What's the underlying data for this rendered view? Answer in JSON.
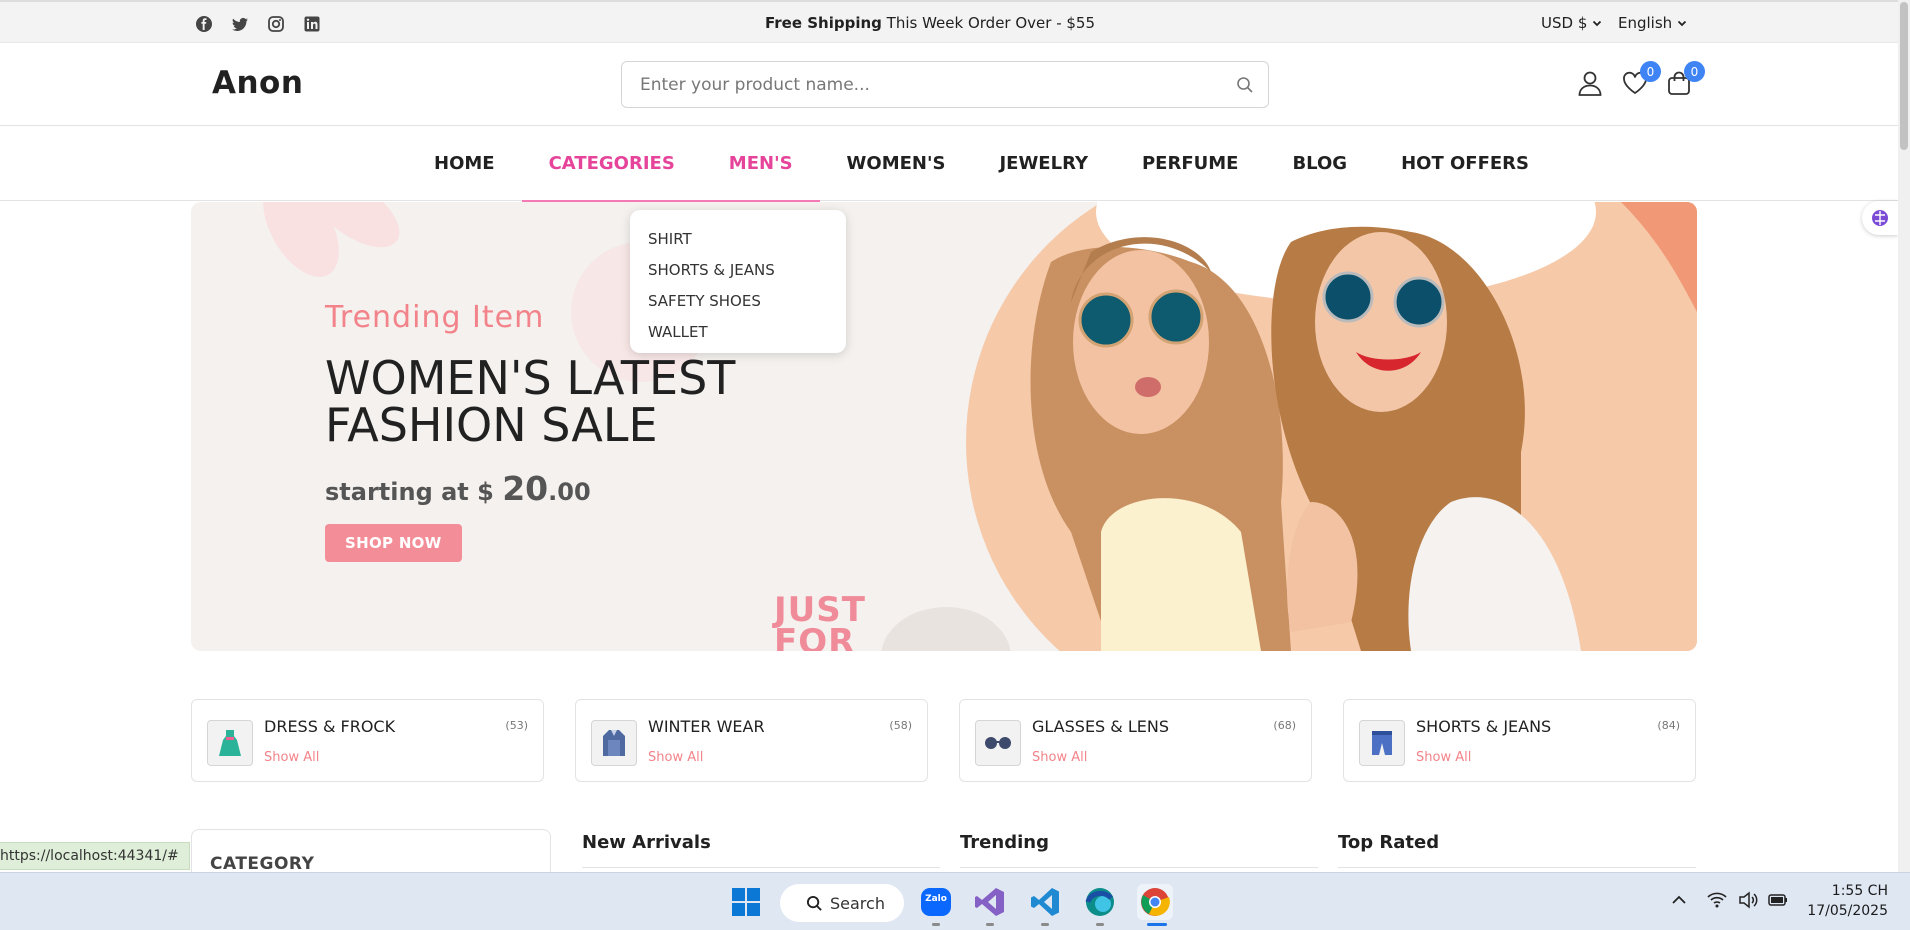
{
  "topbar": {
    "social_icons": [
      "facebook-icon",
      "twitter-icon",
      "instagram-icon",
      "linkedin-icon"
    ],
    "promo_bold": "Free Shipping",
    "promo_text": "This Week Order Over - $55",
    "currency": "USD $",
    "language": "English"
  },
  "header": {
    "logo": "Anon",
    "search_placeholder": "Enter your product name...",
    "wishlist_count": "0",
    "cart_count": "0"
  },
  "nav": {
    "items": [
      "HOME",
      "CATEGORIES",
      "MEN'S",
      "WOMEN'S",
      "JEWELRY",
      "PERFUME",
      "BLOG",
      "HOT OFFERS"
    ]
  },
  "dropdown": {
    "items": [
      "SHIRT",
      "SHORTS & JEANS",
      "SAFETY SHOES",
      "WALLET"
    ]
  },
  "hero": {
    "subtitle": "Trending Item",
    "title_line1": "WOMEN'S LATEST",
    "title_line2": "FASHION SALE",
    "price_prefix": "starting at $ ",
    "price_big": "20",
    "price_cents": ".00",
    "button": "SHOP NOW",
    "overlay_text": "JUST\nFOR"
  },
  "categories": [
    {
      "name": "DRESS & FROCK",
      "count": "(53)",
      "link": "Show All",
      "icon": "dress-icon"
    },
    {
      "name": "WINTER WEAR",
      "count": "(58)",
      "link": "Show All",
      "icon": "coat-icon"
    },
    {
      "name": "GLASSES & LENS",
      "count": "(68)",
      "link": "Show All",
      "icon": "glasses-icon"
    },
    {
      "name": "SHORTS & JEANS",
      "count": "(84)",
      "link": "Show All",
      "icon": "shorts-icon"
    }
  ],
  "sidebar": {
    "category_title": "CATEGORY"
  },
  "sections": [
    "New Arrivals",
    "Trending",
    "Top Rated"
  ],
  "status_url": "https://localhost:44341/#",
  "taskbar": {
    "search_label": "Search",
    "time": "1:55 CH",
    "date": "17/05/2025",
    "zalo_label": "Zalo"
  },
  "colors": {
    "accent_pink": "#e6449a",
    "hero_pink": "#f3838a",
    "badge_blue": "#3e84f5"
  }
}
